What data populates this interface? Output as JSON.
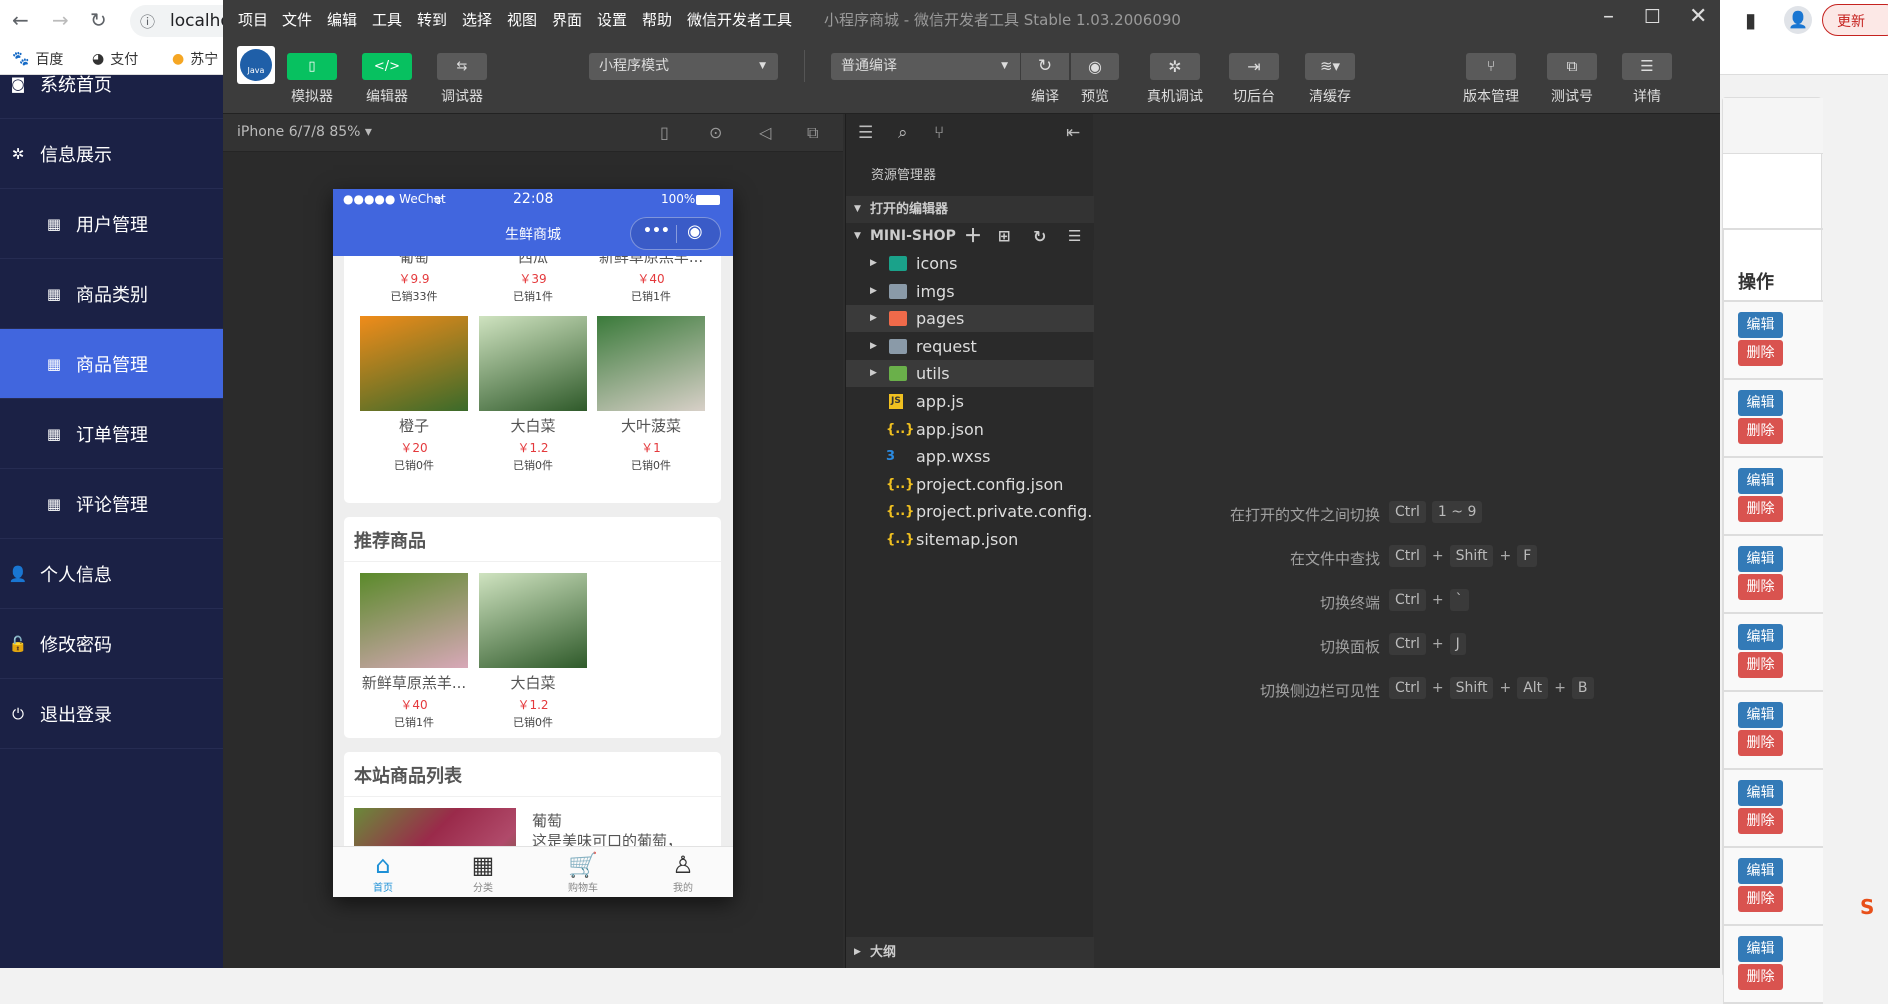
{
  "browser": {
    "address": "localhost",
    "update_label": "更新",
    "bookmarks": [
      {
        "label": "百度"
      },
      {
        "label": "支付"
      },
      {
        "label": "苏宁"
      }
    ]
  },
  "sidebar": {
    "items": [
      {
        "label": "系统首页",
        "icon": "dashboard-icon",
        "level": "top"
      },
      {
        "label": "信息展示",
        "icon": "asterisk-icon",
        "level": "top"
      },
      {
        "label": "用户管理",
        "icon": "table-icon",
        "level": "sub"
      },
      {
        "label": "商品类别",
        "icon": "table-icon",
        "level": "sub"
      },
      {
        "label": "商品管理",
        "icon": "table-icon",
        "level": "sub",
        "active": true
      },
      {
        "label": "订单管理",
        "icon": "table-icon",
        "level": "sub"
      },
      {
        "label": "评论管理",
        "icon": "table-icon",
        "level": "sub"
      },
      {
        "label": "个人信息",
        "icon": "user-icon",
        "level": "top"
      },
      {
        "label": "修改密码",
        "icon": "lock-icon",
        "level": "top"
      },
      {
        "label": "退出登录",
        "icon": "power-icon",
        "level": "top"
      }
    ]
  },
  "webpage": {
    "column_header": "操作",
    "edit_label": "编辑",
    "delete_label": "删除",
    "row_count": 9
  },
  "devtools": {
    "menu": [
      "项目",
      "文件",
      "编辑",
      "工具",
      "转到",
      "选择",
      "视图",
      "界面",
      "设置",
      "帮助",
      "微信开发者工具"
    ],
    "window_title": "小程序商城 - 微信开发者工具 Stable 1.03.2006090",
    "toolbar": {
      "simulator": "模拟器",
      "editor": "编辑器",
      "debugger": "调试器",
      "mode_select": "小程序模式",
      "compile_select": "普通编译",
      "compile": "编译",
      "preview": "预览",
      "remote_debug": "真机调试",
      "background": "切后台",
      "clear_cache": "清缓存",
      "version": "版本管理",
      "test_account": "测试号",
      "details": "详情",
      "logo_text": "Java"
    },
    "simulator": {
      "device": "iPhone 6/7/8 85% ▾"
    },
    "phone": {
      "status": {
        "carrier": "●●●●● WeChat",
        "time": "22:08",
        "battery": "100%"
      },
      "nav_title": "生鲜商城",
      "top_goods": [
        {
          "name": "葡萄",
          "price": "￥9.9",
          "sold": "已销33件",
          "colors": [
            "#8a3a6a",
            "#c9a0b8"
          ]
        },
        {
          "name": "西瓜",
          "price": "￥39",
          "sold": "已销1件",
          "colors": [
            "#d94a4a",
            "#f08080"
          ]
        },
        {
          "name": "新鲜草原羔羊...",
          "price": "￥40",
          "sold": "已销1件",
          "colors": [
            "#4a6a2a",
            "#7a9a4a"
          ]
        },
        {
          "name": "橙子",
          "price": "￥20",
          "sold": "已销0件",
          "colors": [
            "#f08c1a",
            "#3a6a2a"
          ]
        },
        {
          "name": "大白菜",
          "price": "￥1.2",
          "sold": "已销0件",
          "colors": [
            "#cfe3c0",
            "#2f5a2a"
          ]
        },
        {
          "name": "大叶菠菜",
          "price": "￥1",
          "sold": "已销0件",
          "colors": [
            "#3a7a3a",
            "#d8d0c8"
          ]
        }
      ],
      "recommend_title": "推荐商品",
      "recommend": [
        {
          "name": "新鲜草原羔羊...",
          "price": "￥40",
          "sold": "已销1件",
          "colors": [
            "#5a8a2a",
            "#d8a8b8"
          ]
        },
        {
          "name": "大白菜",
          "price": "￥1.2",
          "sold": "已销0件",
          "colors": [
            "#cfe3c0",
            "#2f5a2a"
          ]
        }
      ],
      "list_title": "本站商品列表",
      "list_item": {
        "name": "葡萄",
        "desc": "这是美味可口的葡萄，"
      },
      "tabs": [
        {
          "label": "首页",
          "icon": "home-icon",
          "glyph": "⌂",
          "active": true
        },
        {
          "label": "分类",
          "icon": "grid-icon",
          "glyph": "▦"
        },
        {
          "label": "购物车",
          "icon": "cart-icon",
          "glyph": "🛒"
        },
        {
          "label": "我的",
          "icon": "user-icon",
          "glyph": "♙"
        }
      ]
    },
    "explorer": {
      "title": "资源管理器",
      "open_editors": "打开的编辑器",
      "project": "MINI-SHOP",
      "outline": "大纲",
      "files": [
        {
          "name": "icons",
          "type": "folder",
          "color": "#1aa28a"
        },
        {
          "name": "imgs",
          "type": "folder",
          "color": "#8a9aa8"
        },
        {
          "name": "pages",
          "type": "folder",
          "color": "#f06a4a",
          "hl": true
        },
        {
          "name": "request",
          "type": "folder",
          "color": "#8a9aa8"
        },
        {
          "name": "utils",
          "type": "folder",
          "color": "#6ab04a",
          "hl": true
        },
        {
          "name": "app.js",
          "type": "js",
          "glyph": "JS",
          "color": "#f0c020"
        },
        {
          "name": "app.json",
          "type": "json",
          "glyph": "{..}",
          "color": "#f0c020"
        },
        {
          "name": "app.wxss",
          "type": "css",
          "glyph": "3",
          "color": "#2a8ae0"
        },
        {
          "name": "project.config.json",
          "type": "json",
          "glyph": "{..}",
          "color": "#f0c020"
        },
        {
          "name": "project.private.config...",
          "type": "json",
          "glyph": "{..}",
          "color": "#f0c020"
        },
        {
          "name": "sitemap.json",
          "type": "json",
          "glyph": "{..}",
          "color": "#f0c020"
        }
      ]
    },
    "shortcuts": [
      {
        "desc": "在打开的文件之间切换",
        "keys": [
          "Ctrl",
          "1 ~ 9"
        ],
        "joined": false
      },
      {
        "desc": "在文件中查找",
        "keys": [
          "Ctrl",
          "Shift",
          "F"
        ],
        "joined": true
      },
      {
        "desc": "切换终端",
        "keys": [
          "Ctrl",
          "`"
        ],
        "joined": true
      },
      {
        "desc": "切换面板",
        "keys": [
          "Ctrl",
          "J"
        ],
        "joined": true
      },
      {
        "desc": "切换侧边栏可见性",
        "keys": [
          "Ctrl",
          "Shift",
          "Alt",
          "B"
        ],
        "joined": true
      }
    ]
  }
}
